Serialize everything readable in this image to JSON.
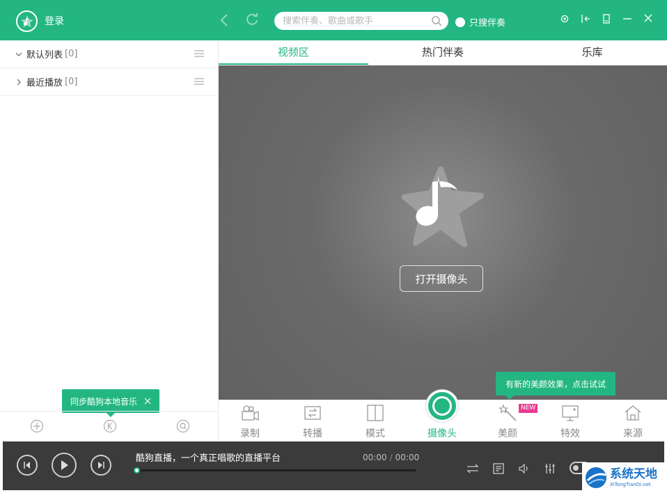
{
  "header": {
    "login_label": "登录",
    "search_placeholder": "搜索伴奏、歌曲或歌手",
    "only_accompaniment_label": "只搜伴奏",
    "brand_color": "#23b682"
  },
  "sidebar": {
    "lists": [
      {
        "label": "默认列表",
        "count": "[0]",
        "expanded": true
      },
      {
        "label": "最近播放",
        "count": "[0]",
        "expanded": false
      }
    ],
    "sync_tooltip": "同步酷狗本地音乐"
  },
  "tabs": [
    {
      "label": "视频区",
      "active": true
    },
    {
      "label": "热门伴奏",
      "active": false
    },
    {
      "label": "乐库",
      "active": false
    }
  ],
  "video": {
    "open_camera_label": "打开摄像头"
  },
  "beauty_tooltip": "有新的美颜效果，点击试试",
  "toolbar": {
    "items": [
      {
        "label": "录制",
        "icon": "camera-record-icon"
      },
      {
        "label": "转播",
        "icon": "relay-icon"
      },
      {
        "label": "模式",
        "icon": "layout-mode-icon"
      },
      {
        "label": "摄像头",
        "icon": "camera-lens-icon"
      },
      {
        "label": "美颜",
        "icon": "magic-wand-icon"
      },
      {
        "label": "特效",
        "icon": "effects-icon"
      },
      {
        "label": "来源",
        "icon": "home-source-icon"
      }
    ],
    "new_badge": "NEW"
  },
  "player": {
    "title": "酷狗直播，一个真正唱歌的直播平台",
    "current_time": "00:00",
    "separator": "/",
    "total_time": "00:00",
    "progress": 0
  },
  "watermark": {
    "title": "系统天地",
    "subtitle": "XiTongTianDi.net"
  }
}
